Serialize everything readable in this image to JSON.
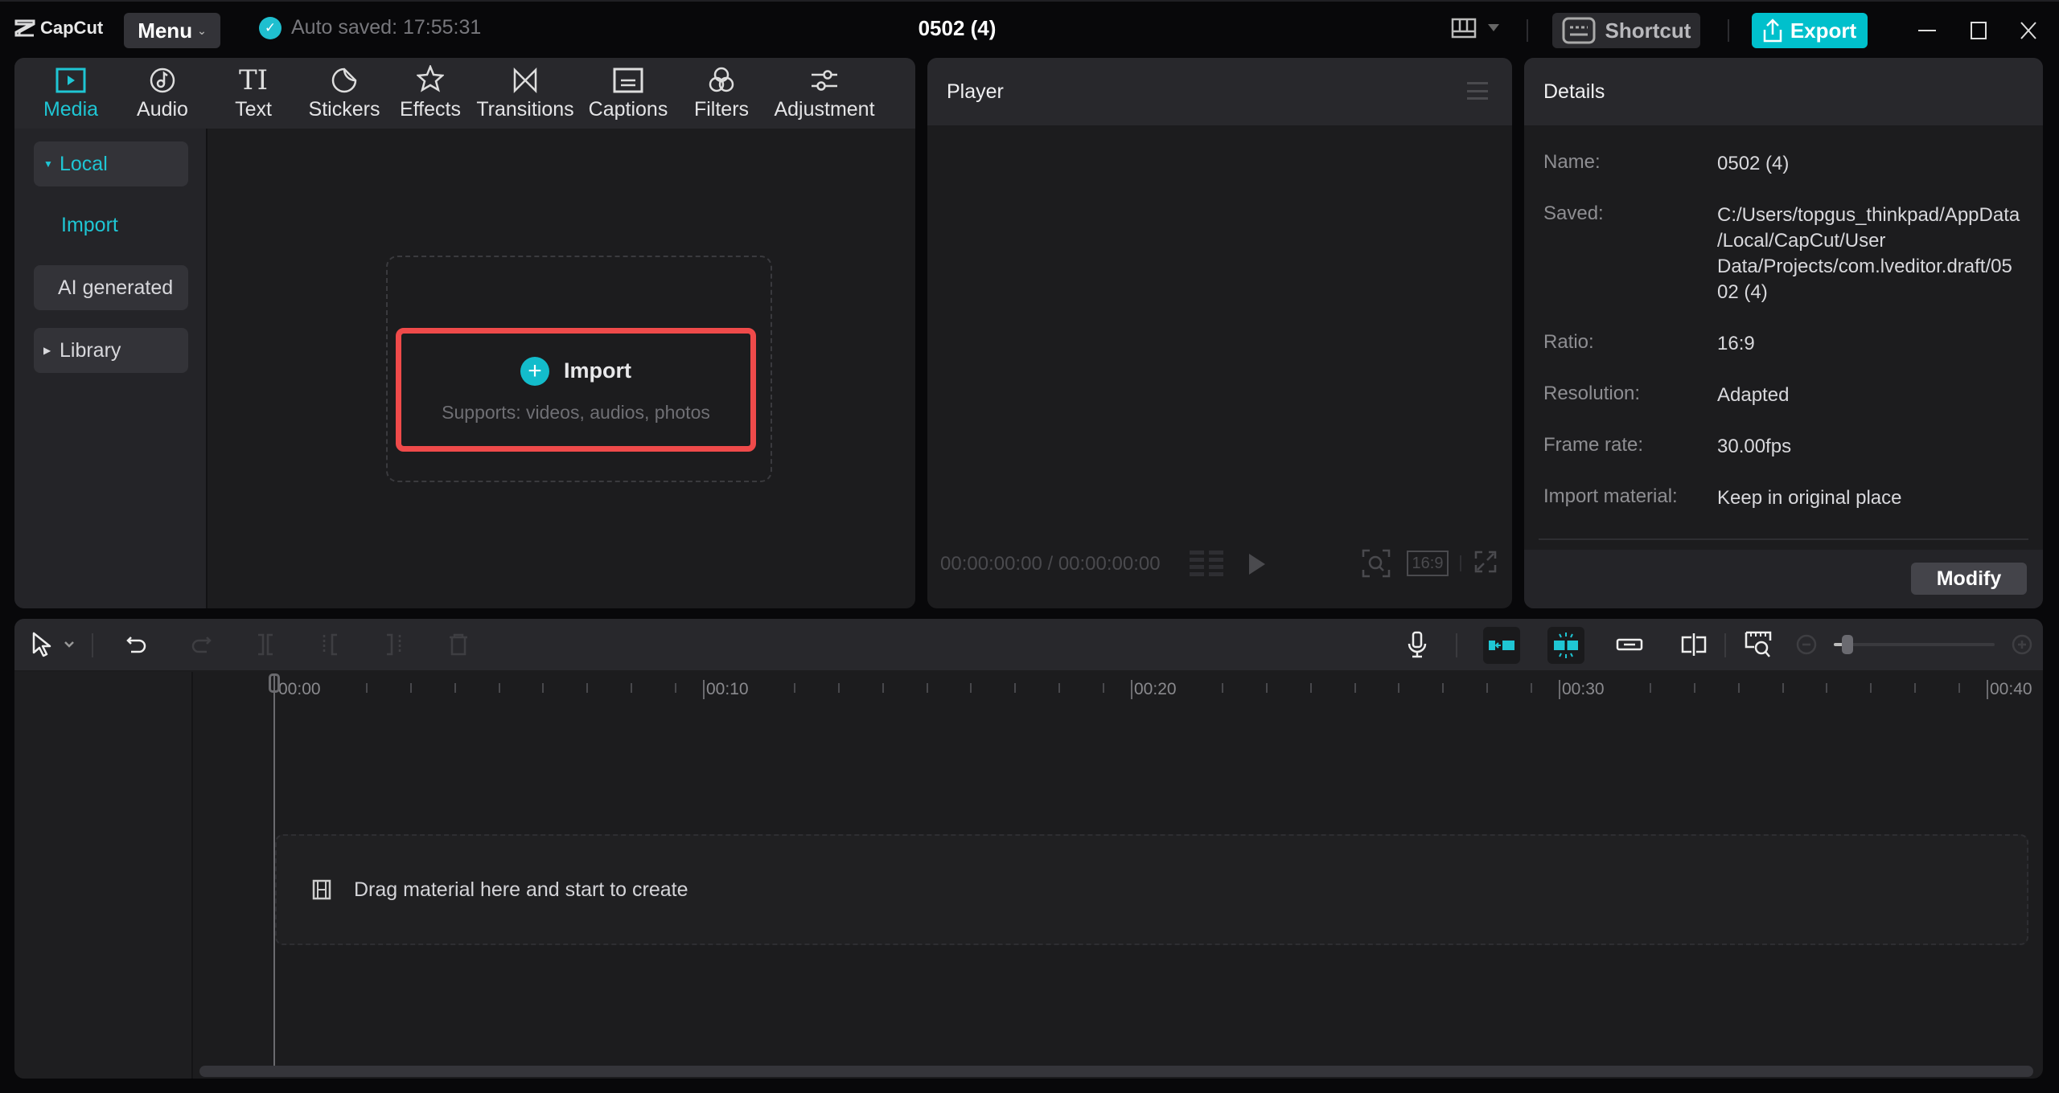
{
  "app": {
    "logo_text": "CapCut",
    "menu_label": "Menu",
    "autosave_text": "Auto saved: 17:55:31",
    "project_title": "0502 (4)",
    "shortcut_label": "Shortcut",
    "export_label": "Export",
    "accent_color": "#00c0cc",
    "highlight_color": "#ef4a4a"
  },
  "tabs": [
    {
      "label": "Media",
      "icon": "media-icon",
      "active": true
    },
    {
      "label": "Audio",
      "icon": "audio-icon",
      "active": false
    },
    {
      "label": "Text",
      "icon": "text-icon",
      "active": false
    },
    {
      "label": "Stickers",
      "icon": "stickers-icon",
      "active": false
    },
    {
      "label": "Effects",
      "icon": "effects-icon",
      "active": false
    },
    {
      "label": "Transitions",
      "icon": "transitions-icon",
      "active": false
    },
    {
      "label": "Captions",
      "icon": "captions-icon",
      "active": false
    },
    {
      "label": "Filters",
      "icon": "filters-icon",
      "active": false
    },
    {
      "label": "Adjustment",
      "icon": "adjustment-icon",
      "active": false
    }
  ],
  "sidebar": {
    "items": [
      {
        "label": "Local",
        "expanded": true,
        "active": true
      },
      {
        "label": "Import",
        "active": true
      },
      {
        "label": "AI generated"
      },
      {
        "label": "Library",
        "expanded": false
      }
    ]
  },
  "media": {
    "import_label": "Import",
    "supports_text": "Supports: videos, audios, photos"
  },
  "player": {
    "title": "Player",
    "current_time": "00:00:00:00",
    "separator": "/",
    "total_time": "00:00:00:00",
    "ratio_label": "16:9"
  },
  "details": {
    "title": "Details",
    "rows": [
      {
        "key": "Name:",
        "value": "0502 (4)"
      },
      {
        "key": "Saved:",
        "value": "C:/Users/topgus_thinkpad/AppData/Local/CapCut/User Data/Projects/com.lveditor.draft/0502 (4)"
      },
      {
        "key": "Ratio:",
        "value": "16:9"
      },
      {
        "key": "Resolution:",
        "value": "Adapted"
      },
      {
        "key": "Frame rate:",
        "value": "30.00fps"
      },
      {
        "key": "Import material:",
        "value": "Keep in original place"
      }
    ],
    "modify_label": "Modify"
  },
  "timeline": {
    "ruler_labels": [
      "00:00",
      "00:10",
      "00:20",
      "00:30",
      "00:40"
    ],
    "drop_hint": "Drag material here and start to create",
    "zoom_level": 0.05
  }
}
